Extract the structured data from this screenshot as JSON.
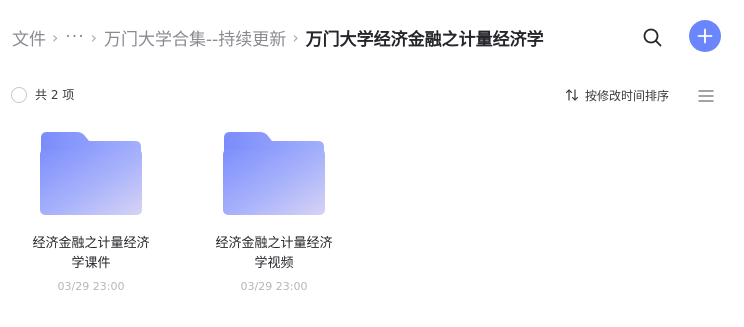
{
  "breadcrumb": {
    "root": "文件",
    "ellipsis": "···",
    "parent": "万门大学合集--持续更新",
    "current": "万门大学经济金融之计量经济学",
    "separator": "›"
  },
  "header": {
    "search_icon": "search-icon",
    "add_icon": "plus-icon",
    "accent_color": "#6b86fd"
  },
  "toolbar": {
    "item_count": "共 2 项",
    "sort_label": "按修改时间排序",
    "sort_icon": "sort-arrows-icon",
    "view_icon": "list-view-icon"
  },
  "files": [
    {
      "name": "经济金融之计量经济学课件",
      "date": "03/29 23:00",
      "type": "folder"
    },
    {
      "name": "经济金融之计量经济学视频",
      "date": "03/29 23:00",
      "type": "folder"
    }
  ]
}
